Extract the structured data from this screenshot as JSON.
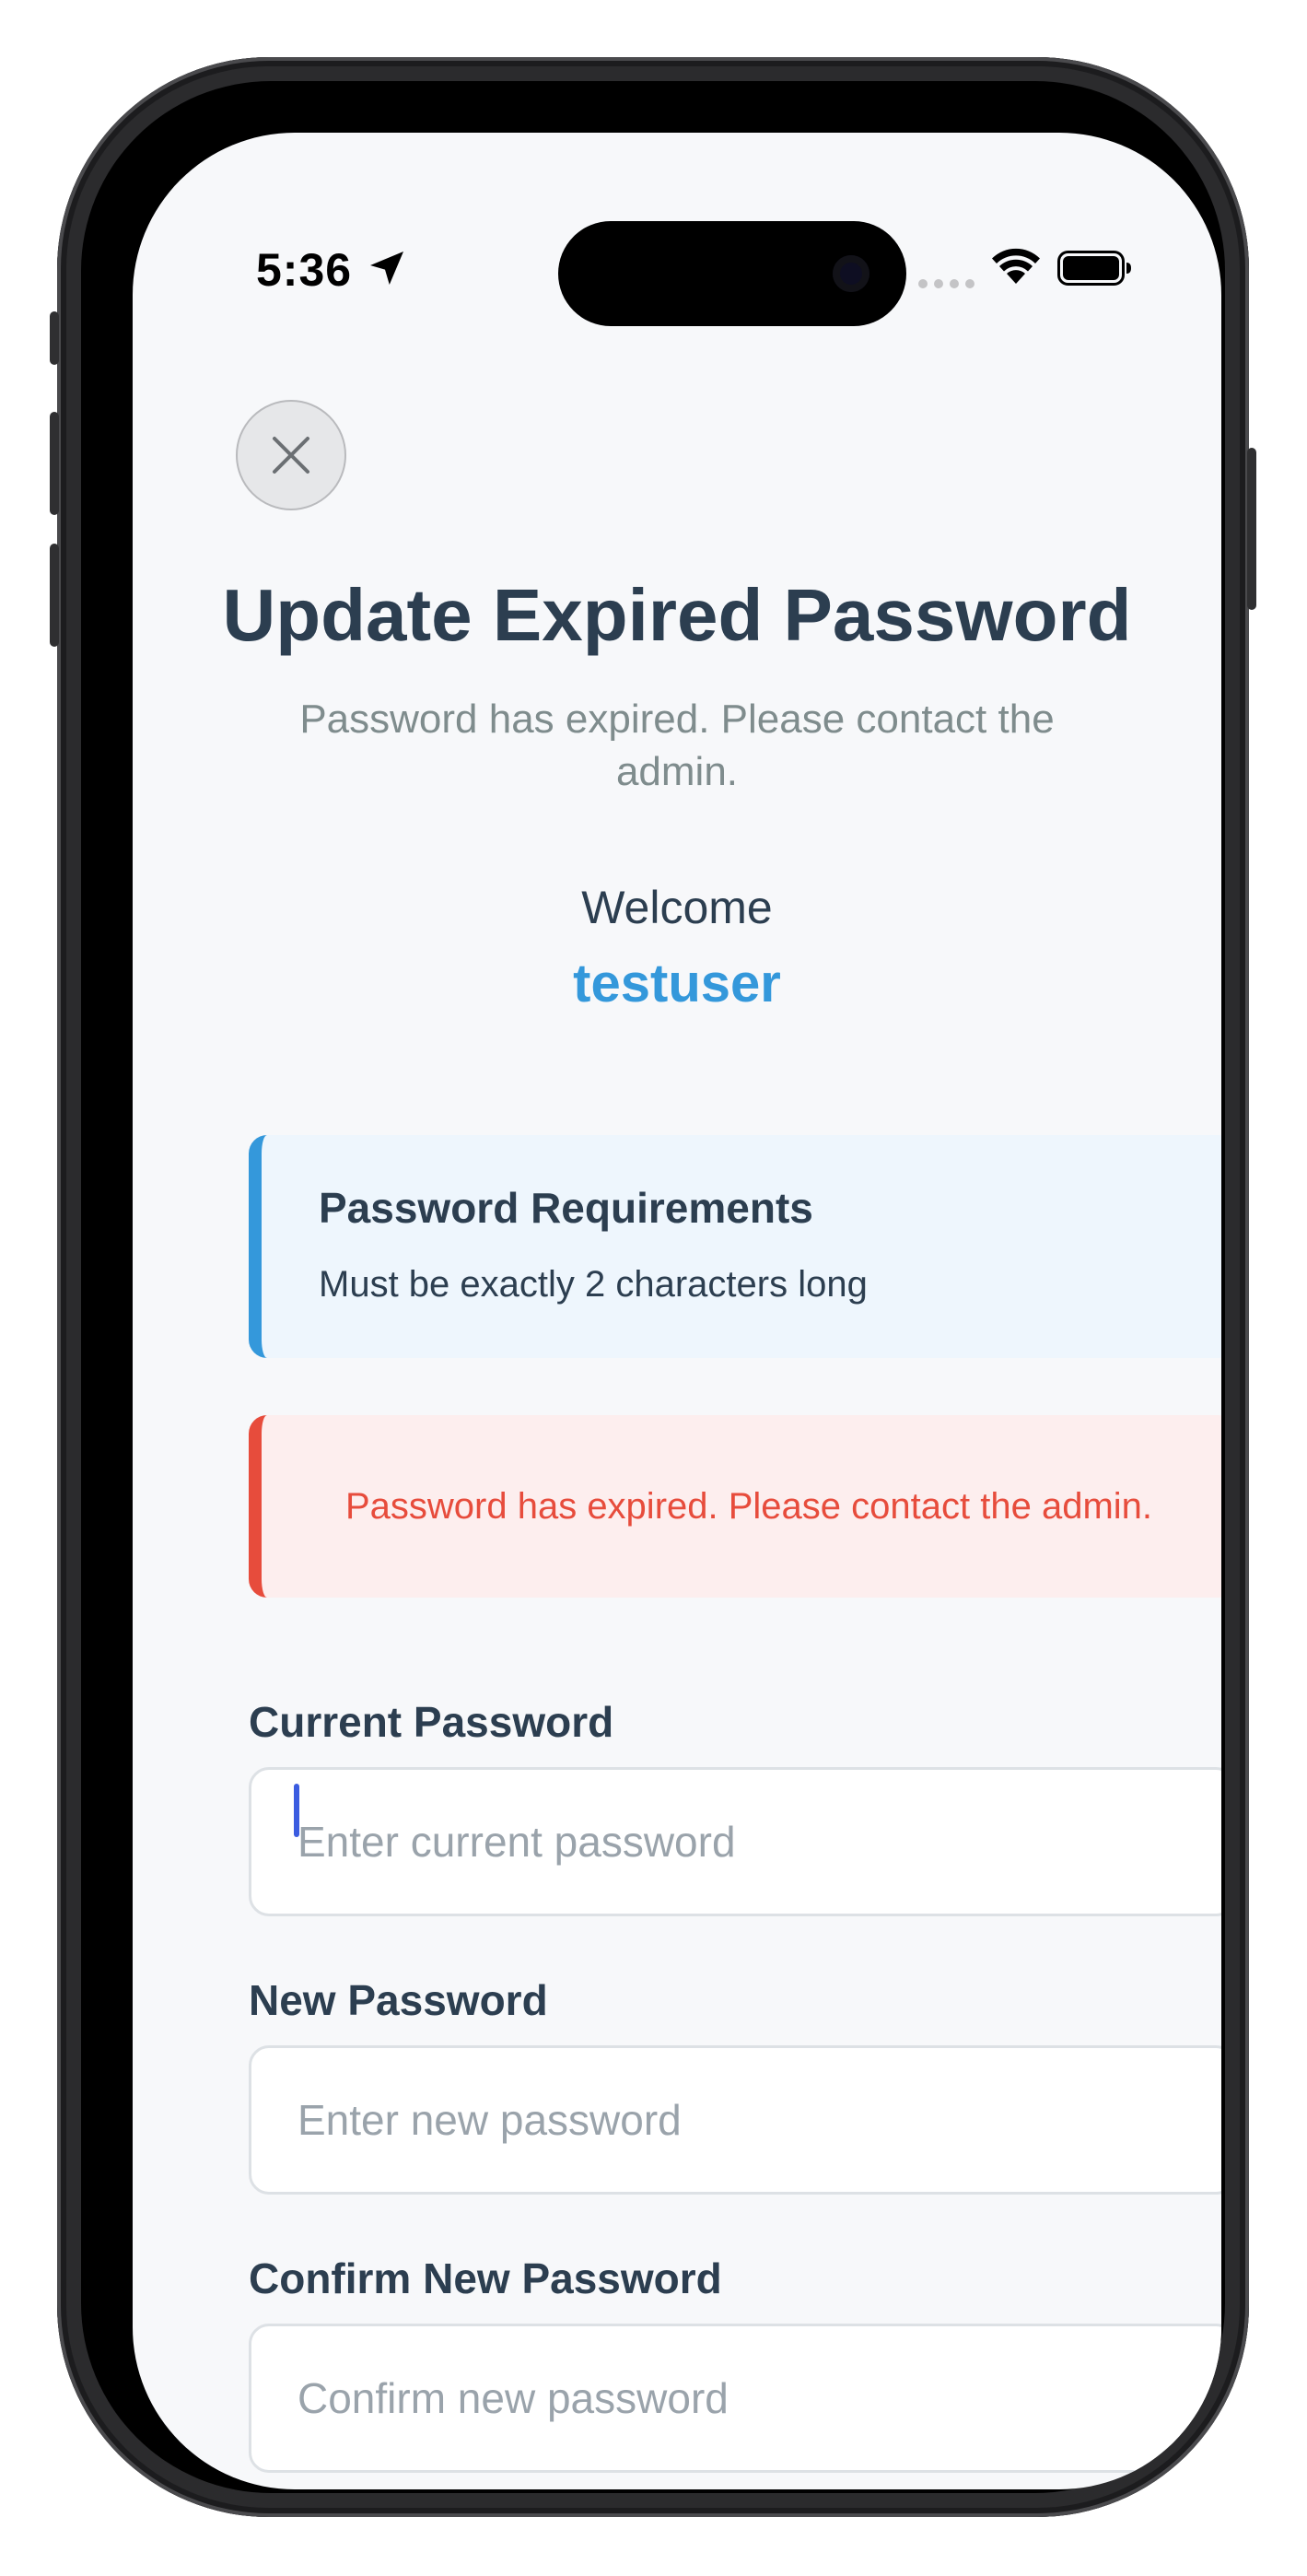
{
  "status_bar": {
    "time": "5:36",
    "location_icon": "location-arrow-icon",
    "signal_icon": "cellular-signal-icon",
    "wifi_icon": "wifi-icon",
    "battery_icon": "battery-full-icon"
  },
  "header": {
    "close_icon": "close-icon",
    "title": "Update Expired Password",
    "subtitle": "Password has expired. Please contact the admin."
  },
  "welcome": {
    "label": "Welcome",
    "username": "testuser"
  },
  "requirements": {
    "title": "Password Requirements",
    "items": [
      "Must be exactly 2 characters long"
    ]
  },
  "error": {
    "message": "Password has expired. Please contact the admin."
  },
  "form": {
    "current_password": {
      "label": "Current Password",
      "value": "",
      "placeholder": "Enter current password"
    },
    "new_password": {
      "label": "New Password",
      "value": "",
      "placeholder": "Enter new password"
    },
    "confirm_password": {
      "label": "Confirm New Password",
      "value": "",
      "placeholder": "Confirm new password"
    }
  },
  "colors": {
    "primary_text": "#2c3e50",
    "muted_text": "#7f8c8d",
    "accent_blue": "#3498db",
    "error_red": "#e74c3c",
    "info_bg": "#eef6fd",
    "error_bg": "#fdeeee",
    "screen_bg": "#f7f8fa"
  }
}
